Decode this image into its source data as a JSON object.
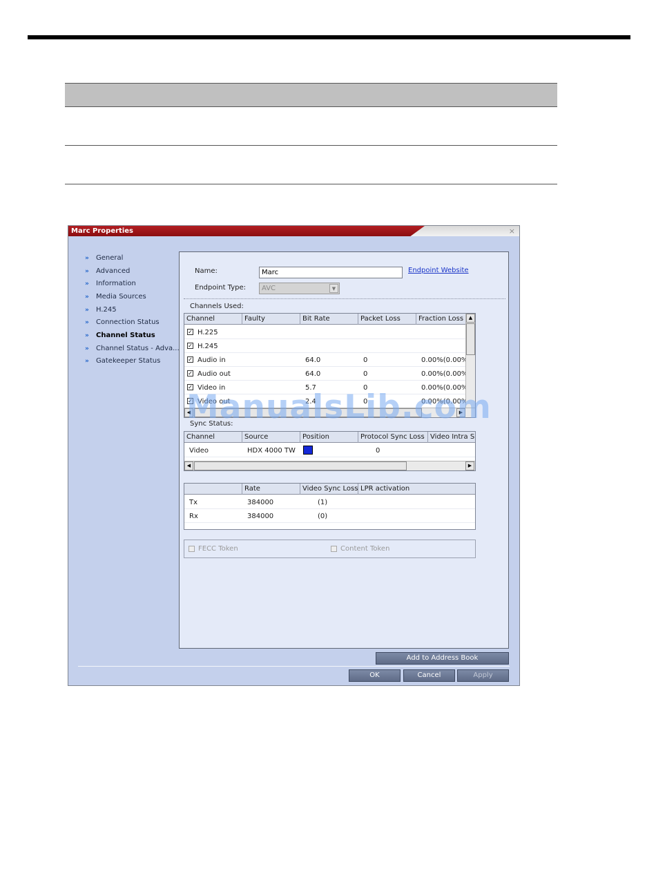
{
  "dialog": {
    "title": "Marc Properties",
    "close_glyph": "×",
    "nav": [
      {
        "label": "General",
        "active": false
      },
      {
        "label": "Advanced",
        "active": false
      },
      {
        "label": "Information",
        "active": false
      },
      {
        "label": "Media Sources",
        "active": false
      },
      {
        "label": "H.245",
        "active": false
      },
      {
        "label": "Connection Status",
        "active": false
      },
      {
        "label": "Channel Status",
        "active": true
      },
      {
        "label": "Channel Status - Adva...",
        "active": false
      },
      {
        "label": "Gatekeeper Status",
        "active": false
      }
    ],
    "name_label": "Name:",
    "name_value": "Marc",
    "endpoint_link": "Endpoint Website",
    "endpoint_type_label": "Endpoint Type:",
    "endpoint_type_value": "AVC",
    "channels_used_label": "Channels Used:",
    "channels": {
      "headers": [
        "Channel",
        "Faulty",
        "Bit Rate",
        "Packet Loss",
        "Fraction Loss"
      ],
      "rows": [
        {
          "checked": true,
          "channel": "H.225",
          "faulty": "",
          "bit_rate": "",
          "packet_loss": "",
          "fraction_loss": ""
        },
        {
          "checked": true,
          "channel": "H.245",
          "faulty": "",
          "bit_rate": "",
          "packet_loss": "",
          "fraction_loss": ""
        },
        {
          "checked": true,
          "channel": "Audio in",
          "faulty": "",
          "bit_rate": "64.0",
          "packet_loss": "0",
          "fraction_loss": "0.00%(0.00%"
        },
        {
          "checked": true,
          "channel": "Audio out",
          "faulty": "",
          "bit_rate": "64.0",
          "packet_loss": "0",
          "fraction_loss": "0.00%(0.00%"
        },
        {
          "checked": true,
          "channel": "Video in",
          "faulty": "",
          "bit_rate": "5.7",
          "packet_loss": "0",
          "fraction_loss": "0.00%(0.00%"
        },
        {
          "checked": true,
          "channel": "Video out",
          "faulty": "",
          "bit_rate": "2.4",
          "packet_loss": "0",
          "fraction_loss": "0.00%(0.00%"
        }
      ]
    },
    "sync_status_label": "Sync Status:",
    "sync": {
      "headers": [
        "Channel",
        "Source",
        "Position",
        "Protocol Sync Loss",
        "Video Intra S"
      ],
      "rows": [
        {
          "channel": "Video",
          "source": "HDX 4000 TW",
          "protocol_sync_loss": "0"
        }
      ]
    },
    "rate": {
      "headers": [
        "",
        "Rate",
        "Video Sync Loss",
        "LPR activation"
      ],
      "rows": [
        {
          "dir": "Tx",
          "rate": "384000",
          "video_sync_loss": "(1)"
        },
        {
          "dir": "Rx",
          "rate": "384000",
          "video_sync_loss": "(0)"
        }
      ]
    },
    "fecc_token_label": "FECC Token",
    "content_token_label": "Content Token",
    "buttons": {
      "add_to_address_book": "Add to Address Book",
      "ok": "OK",
      "cancel": "Cancel",
      "apply": "Apply"
    },
    "scroll_glyphs": {
      "up": "▲",
      "down": "▼",
      "left": "◀",
      "right": "▶",
      "dropdown": "▼",
      "nav_chevron": "»",
      "check": "✓"
    }
  },
  "watermark": "ManualsLib.com"
}
